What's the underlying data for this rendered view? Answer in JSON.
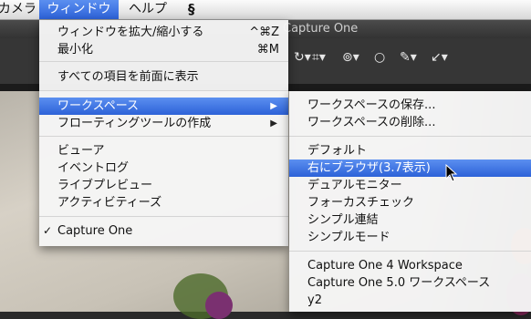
{
  "menubar": {
    "items": [
      "カメラ",
      "ウィンドウ",
      "ヘルプ",
      "script-icon"
    ]
  },
  "app": {
    "title": "Capture One"
  },
  "window_menu": {
    "items": [
      {
        "label": "ウィンドウを拡大/縮小する",
        "shortcut": "^⌘Z"
      },
      {
        "label": "最小化",
        "shortcut": "⌘M"
      },
      {
        "label": "すべての項目を前面に表示"
      },
      {
        "label": "ワークスペース",
        "submenu": true,
        "selected": true
      },
      {
        "label": "フローティングツールの作成",
        "submenu": true
      },
      {
        "label": "ビューア"
      },
      {
        "label": "イベントログ"
      },
      {
        "label": "ライブプレビュー"
      },
      {
        "label": "アクティビティーズ"
      },
      {
        "label": "Capture One",
        "checked": true
      }
    ]
  },
  "workspace_submenu": {
    "items": [
      {
        "label": "ワークスペースの保存..."
      },
      {
        "label": "ワークスペースの削除..."
      },
      {
        "label": "デフォルト"
      },
      {
        "label": "右にブラウザ(3.7表示)",
        "selected": true
      },
      {
        "label": "デュアルモニター"
      },
      {
        "label": "フォーカスチェック"
      },
      {
        "label": "シンプル連結"
      },
      {
        "label": "シンプルモード"
      },
      {
        "label": "Capture One 4 Workspace"
      },
      {
        "label": "Capture One 5.0 ワークスペース"
      },
      {
        "label": "y2"
      }
    ]
  },
  "colors": {
    "highlight": "#3f74e4",
    "menu_bg": "#f5f5f5"
  }
}
